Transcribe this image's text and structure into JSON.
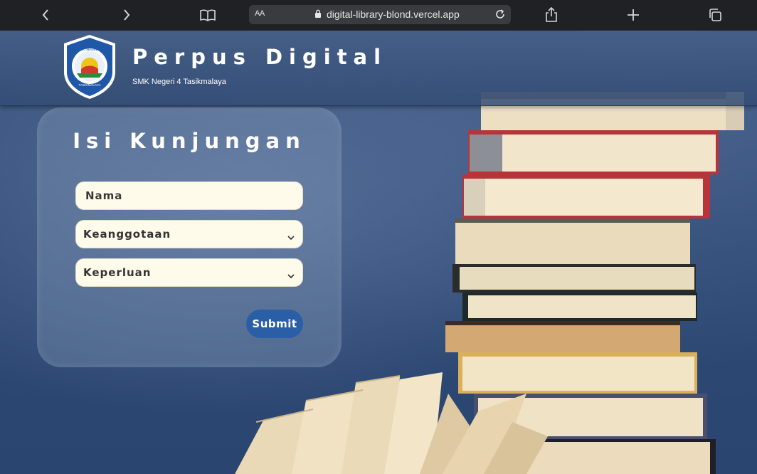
{
  "browser": {
    "text_size_label": "AA",
    "url": "digital-library-blond.vercel.app",
    "icons": [
      "back-icon",
      "forward-icon",
      "bookmarks-icon",
      "lock-icon",
      "reload-icon",
      "share-icon",
      "new-tab-icon",
      "tabs-icon"
    ]
  },
  "header": {
    "title": "Perpus Digital",
    "subtitle": "SMK Negeri 4 Tasikmalaya",
    "logo": {
      "top_text": "SMK NEGERI 4",
      "bottom_text": "TASIKMALAYA"
    }
  },
  "form": {
    "title": "Isi Kunjungan",
    "name_placeholder": "Nama",
    "membership_label": "Keanggotaan",
    "purpose_label": "Keperluan",
    "submit_label": "Submit"
  },
  "colors": {
    "browser_bar": "#202124",
    "background": "#2f4a75",
    "submit": "#2a5ea6",
    "field": "#fffbea"
  }
}
